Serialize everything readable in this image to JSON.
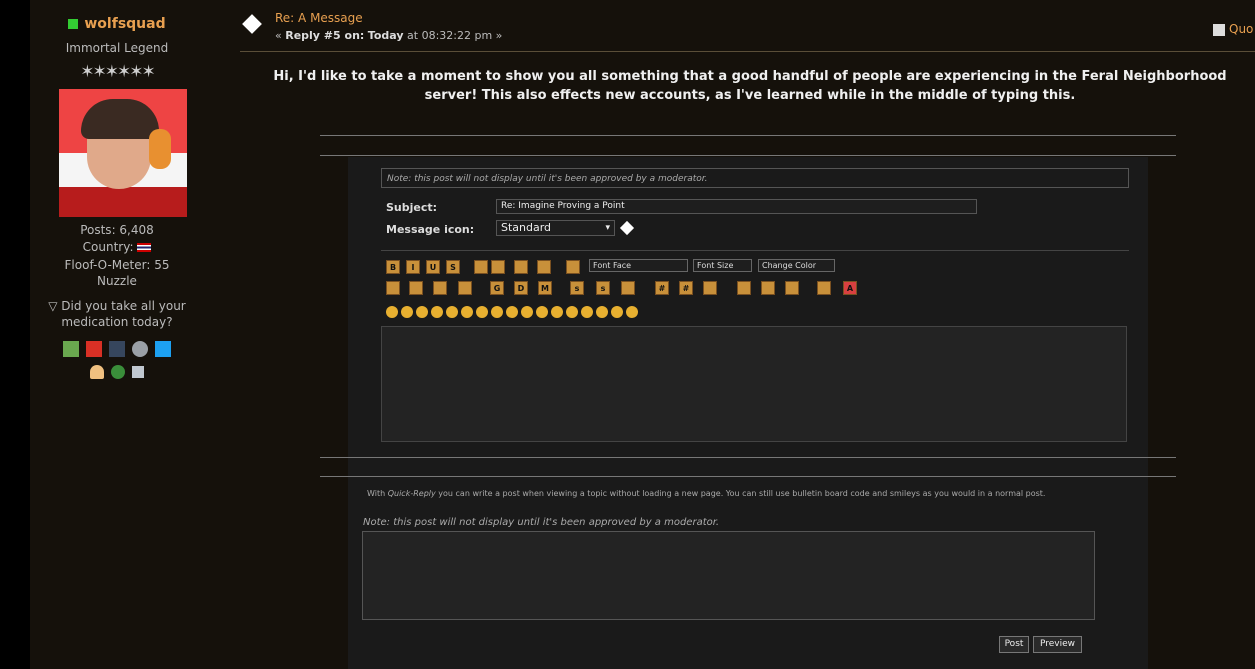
{
  "author": {
    "name": "wolfsquad",
    "title": "Immortal Legend",
    "stars": "✶✶✶✶✶✶",
    "posts": "Posts: 6,408",
    "country_label": "Country:",
    "floof": "Floof-O-Meter: 55",
    "group": "Nuzzle",
    "personal_text": "▽ Did you take all your medication today?",
    "social_icons": [
      "deviantart-icon",
      "youtube-icon",
      "tumblr-icon",
      "steam-icon",
      "twitter-icon"
    ],
    "profile_icons": [
      "profile-icon",
      "website-icon",
      "message-icon"
    ]
  },
  "post": {
    "title": "Re: A Message",
    "reply_prefix": "« ",
    "reply_label": "Reply #5 on:",
    "reply_day": "Today",
    "reply_time": " at 08:32:22 pm »",
    "quote_label": "Quo",
    "body": "Hi, I'd like to take a moment to show you all something that a good handful of people are experiencing in the Feral Neighborhood server! This also effects new accounts, as I've learned while in the middle of typing this."
  },
  "reply_form": {
    "note": "Note: this post will not display until it's been approved by a moderator.",
    "subject_label": "Subject:",
    "subject_value": "Re: Imagine Proving a Point",
    "icon_label": "Message icon:",
    "icon_value": "Standard",
    "font_face": "Font Face",
    "font_size": "Font Size",
    "change_color": "Change Color"
  },
  "quick_reply": {
    "desc_prefix": "With ",
    "desc_em": "Quick-Reply",
    "desc_rest": " you can write a post when viewing a topic without loading a new page. You can still use bulletin board code and smileys as you would in a normal post.",
    "note": "Note: this post will not display until it's been approved by a moderator.",
    "post_button": "Post",
    "preview_button": "Preview"
  },
  "colors": {
    "accent": "#e8a050",
    "background": "#15110b",
    "online": "#33cc33"
  }
}
